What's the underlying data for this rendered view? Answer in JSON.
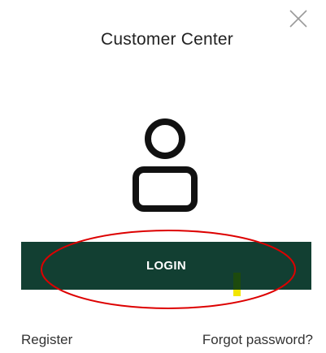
{
  "dialog": {
    "title": "Customer Center",
    "close_icon": "close-icon",
    "user_icon": "user-icon"
  },
  "login": {
    "label": "LOGIN",
    "background_color": "#123f32"
  },
  "links": {
    "register": "Register",
    "forgot_password": "Forgot password?"
  },
  "annotation": {
    "highlight_color": "#dd0000"
  }
}
